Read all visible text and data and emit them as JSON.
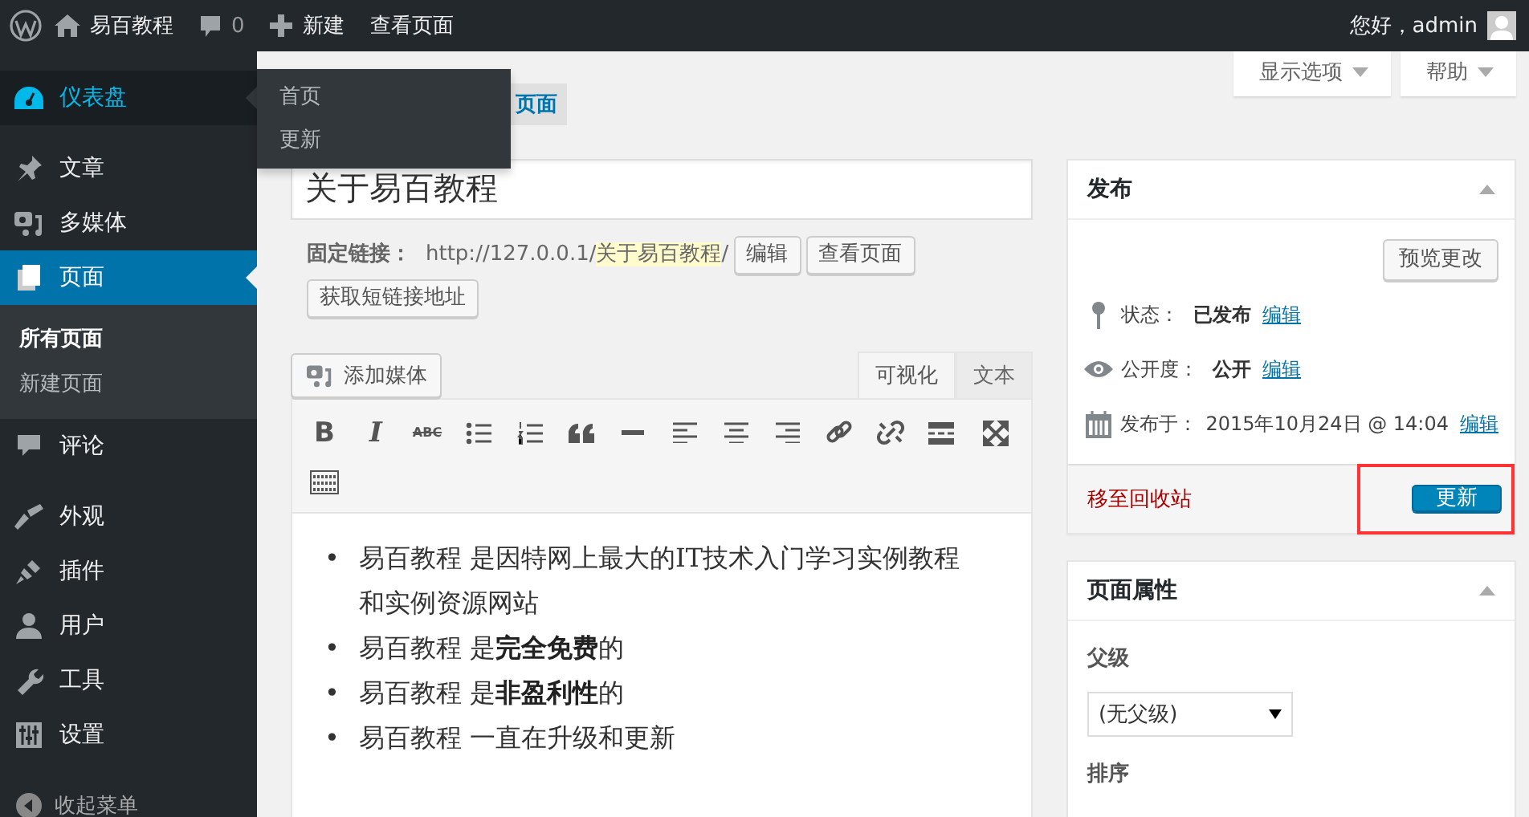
{
  "admin_bar": {
    "site_name": "易百教程",
    "comments": "0",
    "new": "新建",
    "view": "查看页面",
    "greeting": "您好，admin"
  },
  "sidebar": {
    "groups": [
      [
        {
          "label": "仪表盘",
          "selected": false,
          "hovered": true,
          "flyout": [
            "首页",
            "更新"
          ]
        }
      ],
      [
        {
          "label": "文章",
          "selected": false,
          "hovered": false
        },
        {
          "label": "多媒体",
          "selected": false,
          "hovered": false
        },
        {
          "label": "页面",
          "selected": true,
          "hovered": false,
          "children": [
            {
              "label": "所有页面",
              "selected": true
            },
            {
              "label": "新建页面",
              "selected": false
            }
          ]
        },
        {
          "label": "评论",
          "selected": false,
          "hovered": false
        }
      ],
      [
        {
          "label": "外观",
          "selected": false,
          "hovered": false
        },
        {
          "label": "插件",
          "selected": false,
          "hovered": false
        },
        {
          "label": "用户",
          "selected": false,
          "hovered": false
        },
        {
          "label": "工具",
          "selected": false,
          "hovered": false
        },
        {
          "label": "设置",
          "selected": false,
          "hovered": false
        }
      ]
    ],
    "collapse": "收起菜单"
  },
  "screen_meta": [
    "显示选项",
    "帮助"
  ],
  "add_new": "页面",
  "editor": {
    "title": "关于易百教程",
    "permalink_label": "固定链接：",
    "permalink_base": "http://127.0.0.1/",
    "permalink_slug": "关于易百教程",
    "permalink_end": "/",
    "permalink_buttons": [
      "编辑",
      "查看页面",
      "获取短链接地址"
    ],
    "add_media": "添加媒体",
    "tabs": [
      {
        "label": "可视化",
        "selected": true
      },
      {
        "label": "文本",
        "selected": false
      }
    ],
    "toolbar": [
      {
        "kind": "bold",
        "label": "B"
      },
      {
        "kind": "italic",
        "label": "I"
      },
      {
        "kind": "strike",
        "label": "ABC"
      },
      {
        "kind": "ul"
      },
      {
        "kind": "ol"
      },
      {
        "kind": "quote"
      },
      {
        "kind": "hr"
      },
      {
        "kind": "alignleft"
      },
      {
        "kind": "aligncenter"
      },
      {
        "kind": "alignright"
      },
      {
        "kind": "link"
      },
      {
        "kind": "unlink"
      },
      {
        "kind": "more"
      },
      {
        "kind": "fullscreen"
      },
      {
        "kind": "kitchensink"
      }
    ],
    "content": [
      {
        "marker": "•",
        "text": "易百教程 是因特网上最大的IT技术入门学习实例教程和实例资源网站"
      },
      {
        "marker": "•",
        "text": "易百教程 是**完全免费**的"
      },
      {
        "marker": "•",
        "text": "易百教程 是**非盈利性**的"
      },
      {
        "marker": "•",
        "text": "易百教程 一直在升级和更新"
      }
    ]
  },
  "publish": {
    "title": "发布",
    "preview": "预览更改",
    "rows": [
      {
        "kind": "status",
        "label": "状态：",
        "value": "已发布",
        "link": "编辑"
      },
      {
        "kind": "visibility",
        "label": "公开度：",
        "value": "公开",
        "link": "编辑"
      },
      {
        "kind": "date",
        "label": "发布于：",
        "value": "2015年10月24日 @ 14:04",
        "link": "编辑"
      }
    ],
    "trash": "移至回收站",
    "update": {
      "label": "更新",
      "annotated": true
    }
  },
  "attributes": {
    "title": "页面属性",
    "parent_label": "父级",
    "parent_value": "(无父级)",
    "order_label": "排序"
  }
}
